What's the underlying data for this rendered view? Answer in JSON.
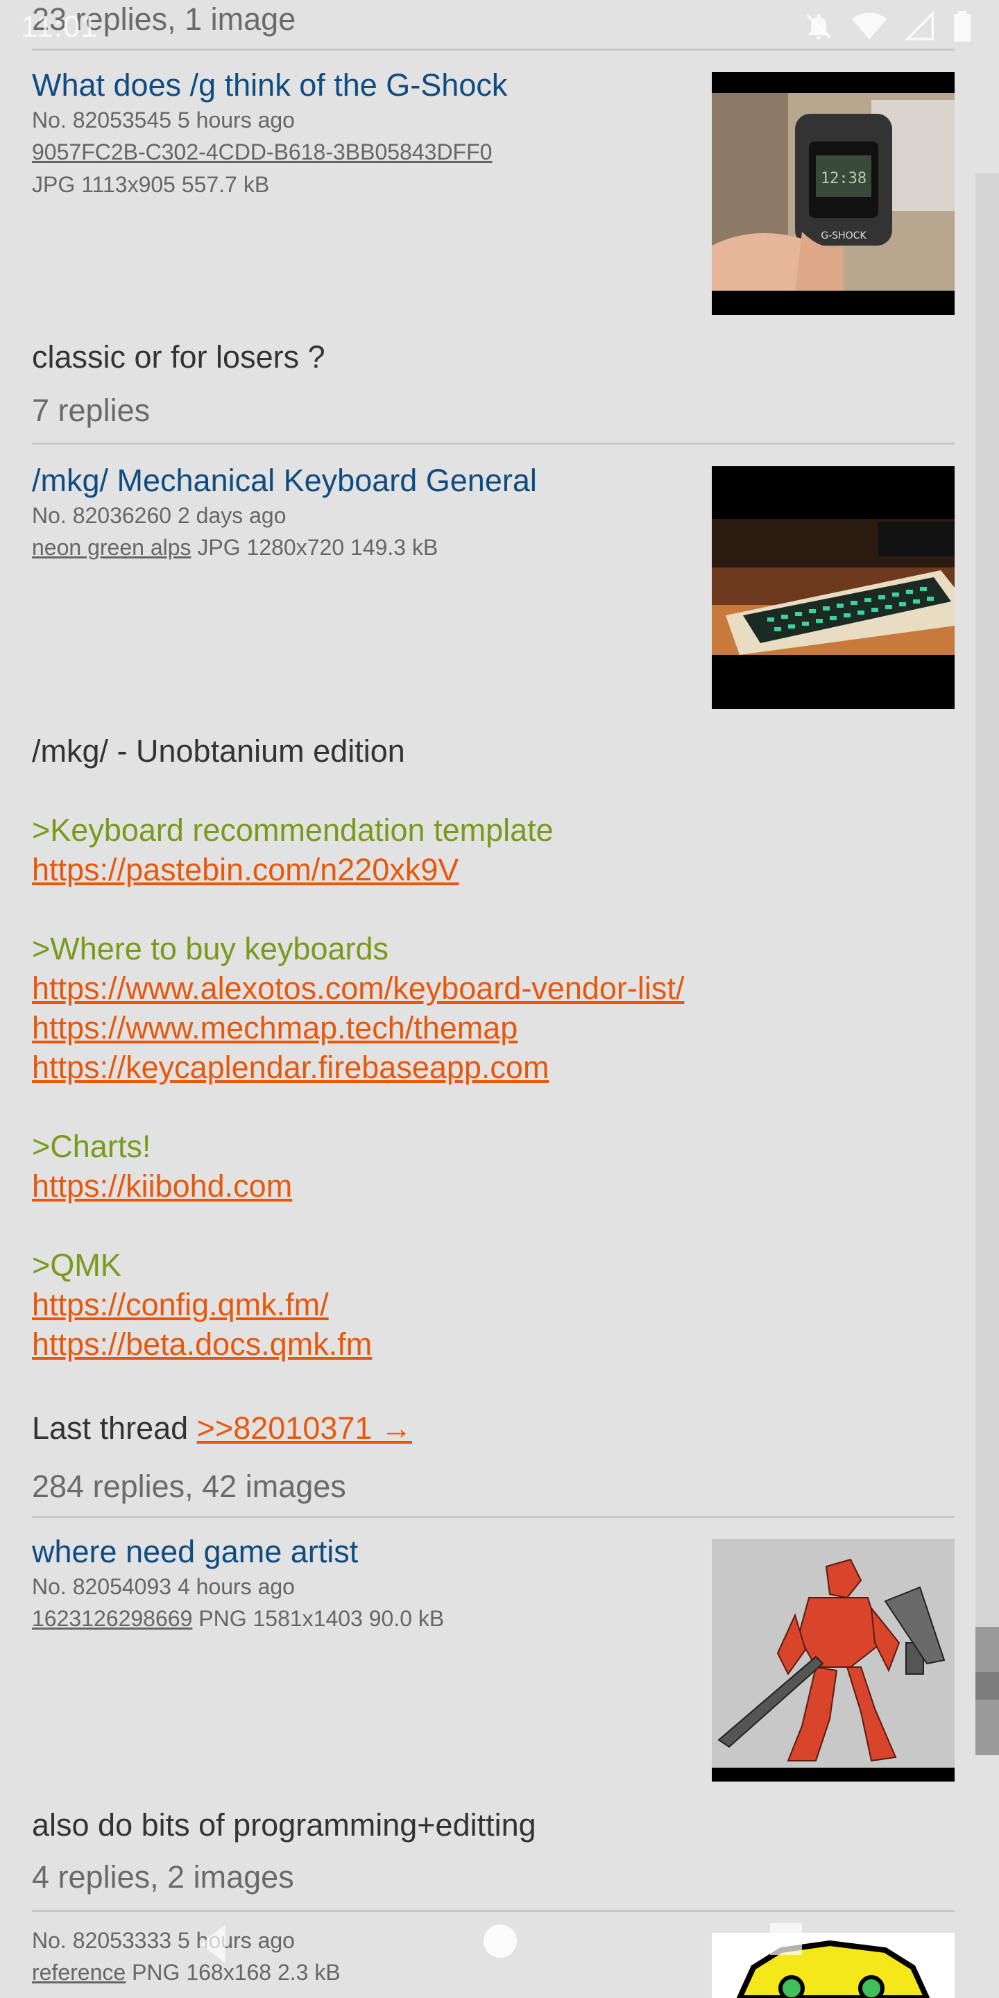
{
  "status_bar": {
    "time": "11:01"
  },
  "top_partial": {
    "replies": "23 replies, 1 image"
  },
  "threads": [
    {
      "subject": "What does /g think of the G-Shock",
      "meta_line": "No. 82053545 5 hours ago",
      "filename": "9057FC2B-C302-4CDD-B618-3BB05843DFF0",
      "fileinfo": "JPG 1113x905 557.7 kB",
      "comment": "classic or for losers ?",
      "replies": "7 replies"
    },
    {
      "subject": "/mkg/ Mechanical Keyboard General",
      "meta_line": "No. 82036260 2 days ago",
      "filename": "neon green alps",
      "fileinfo": "JPG 1280x720 149.3 kB",
      "comment_lines": [
        "/mkg/ - Unobtanium edition",
        "",
        ">Keyboard recommendation template",
        "https://pastebin.com/n220xk9V",
        "",
        ">Where to buy keyboards",
        "https://www.alexotos.com/keyboard-vendor-list/",
        "https://www.mechmap.tech/themap",
        "https://keycaplendar.firebaseapp.com",
        "",
        ">Charts!",
        "https://kiibohd.com",
        "",
        ">QMK",
        "https://config.qmk.fm/",
        "https://beta.docs.qmk.fm",
        ""
      ],
      "last_thread_label": "Last thread",
      "last_thread_link": ">>82010371 →",
      "replies": "284 replies, 42 images"
    },
    {
      "subject": "where need game artist",
      "meta_line": "No. 82054093 4 hours ago",
      "filename": "1623126298669",
      "fileinfo": "PNG 1581x1403 90.0 kB",
      "comment": "also do bits of programming+editting",
      "replies": "4 replies, 2 images"
    },
    {
      "meta_line": "No. 82053333 5 hours ago",
      "filename": "reference",
      "fileinfo": "PNG 168x168 2.3 kB"
    }
  ],
  "colors": {
    "background": "#e2e2e2",
    "subject": "#0f4c81",
    "greentext": "#7a9a1c",
    "link": "#e8580c"
  },
  "icons": [
    "do-not-disturb-icon",
    "wifi-icon",
    "signal-icon",
    "battery-icon",
    "back-icon",
    "home-icon",
    "recents-icon"
  ]
}
